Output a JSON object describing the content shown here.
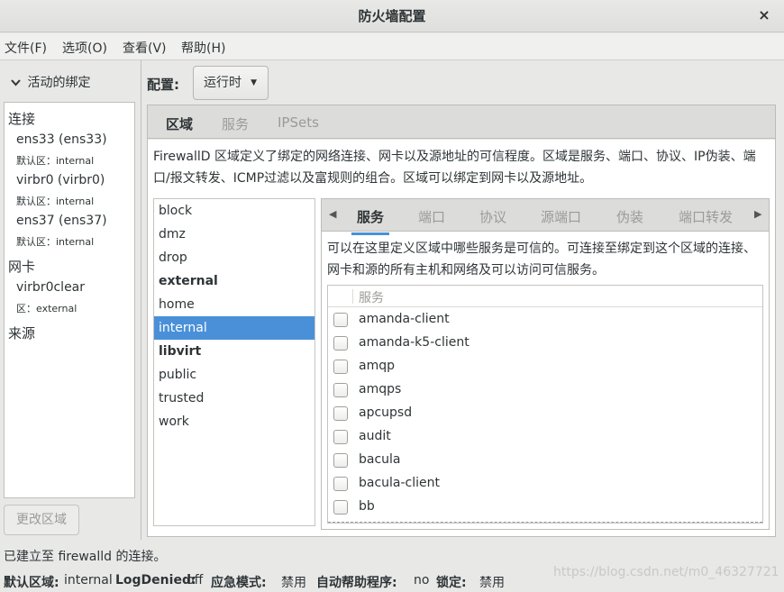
{
  "window": {
    "title": "防火墙配置",
    "close_glyph": "×"
  },
  "menu": [
    "文件(F)",
    "选项(O)",
    "查看(V)",
    "帮助(H)"
  ],
  "left": {
    "expander_label": "活动的绑定",
    "sections": {
      "connections": "连接",
      "interfaces": "网卡",
      "sources": "来源"
    },
    "connections": [
      {
        "name": "ens33 (ens33)",
        "zone": "默认区：internal"
      },
      {
        "name": "virbr0 (virbr0)",
        "zone": "默认区：internal"
      },
      {
        "name": "ens37 (ens37)",
        "zone": "默认区：internal"
      }
    ],
    "interfaces": [
      {
        "name": "virbr0clear",
        "zone": "区：external"
      }
    ],
    "change_zone_button": "更改区域"
  },
  "config": {
    "label": "配置:",
    "value": "运行时"
  },
  "main_tabs": [
    "区域",
    "服务",
    "IPSets"
  ],
  "zone_description": "FirewallD 区域定义了绑定的网络连接、网卡以及源地址的可信程度。区域是服务、端口、协议、IP伪装、端口/报文转发、ICMP过滤以及富规则的组合。区域可以绑定到网卡以及源地址。",
  "zones": [
    "block",
    "dmz",
    "drop",
    "external",
    "home",
    "internal",
    "libvirt",
    "public",
    "trusted",
    "work"
  ],
  "bold_zones": [
    "external",
    "libvirt"
  ],
  "selected_zone": "internal",
  "zone_tabs": [
    "服务",
    "端口",
    "协议",
    "源端口",
    "伪装",
    "端口转发"
  ],
  "services_description": "可以在这里定义区域中哪些服务是可信的。可连接至绑定到这个区域的连接、网卡和源的所有主机和网络及可以访问可信服务。",
  "services_header": "服务",
  "services": [
    "amanda-client",
    "amanda-k5-client",
    "amqp",
    "amqps",
    "apcupsd",
    "audit",
    "bacula",
    "bacula-client",
    "bb"
  ],
  "status": {
    "connection": "已建立至 firewalld 的连接。",
    "default_zone_label": "默认区域:",
    "default_zone_value": "internal",
    "logdenied_label": "LogDenied:",
    "logdenied_value": "off",
    "panic_label": "应急模式:",
    "panic_value": "禁用",
    "helper_label": "自动帮助程序:",
    "helper_value": "no",
    "lock_label": "锁定:",
    "lock_value": "禁用"
  },
  "watermark": "https://blog.csdn.net/m0_46327721",
  "colors": {
    "accent": "#4a90d9"
  }
}
